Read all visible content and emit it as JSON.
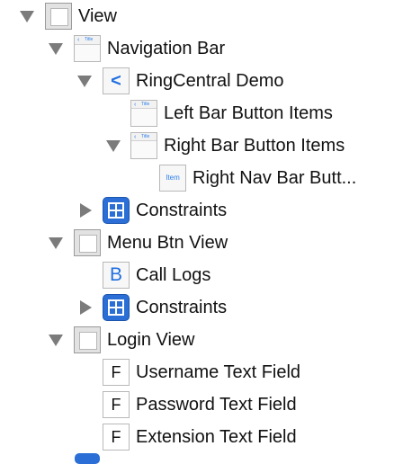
{
  "colors": {
    "disclosure_triangle": "#7b7b7b",
    "accent_blue": "#2b6fd6",
    "icon_border": "#b8b8b8"
  },
  "tree": {
    "view": {
      "label": "View",
      "icon": "view-icon",
      "expanded": true
    },
    "navigation_bar": {
      "label": "Navigation Bar",
      "icon": "navigation-bar-icon",
      "icon_text": "Title",
      "expanded": true
    },
    "ringcentral_demo": {
      "label": "RingCentral Demo",
      "icon": "back-chevron-icon",
      "icon_glyph": "<",
      "expanded": true
    },
    "left_bar_button_items": {
      "label": "Left Bar Button Items",
      "icon": "navigation-bar-icon",
      "icon_text": "Title"
    },
    "right_bar_button_items": {
      "label": "Right Bar Button Items",
      "icon": "navigation-bar-icon",
      "icon_text": "Title",
      "expanded": true
    },
    "right_nav_bar_button": {
      "label": "Right Nav Bar Butt...",
      "icon": "bar-button-item-icon",
      "icon_text": "Item"
    },
    "constraints_1": {
      "label": "Constraints",
      "icon": "constraints-icon",
      "expanded": false
    },
    "menu_btn_view": {
      "label": "Menu Btn View",
      "icon": "view-icon",
      "expanded": true
    },
    "call_logs": {
      "label": "Call Logs",
      "icon": "button-icon",
      "icon_glyph": "B"
    },
    "constraints_2": {
      "label": "Constraints",
      "icon": "constraints-icon",
      "expanded": false
    },
    "login_view": {
      "label": "Login View",
      "icon": "view-icon",
      "expanded": true
    },
    "username_text_field": {
      "label": "Username Text Field",
      "icon": "text-field-icon",
      "icon_glyph": "F"
    },
    "password_text_field": {
      "label": "Password Text Field",
      "icon": "text-field-icon",
      "icon_glyph": "F"
    },
    "extension_text_field": {
      "label": "Extension Text Field",
      "icon": "text-field-icon",
      "icon_glyph": "F"
    }
  }
}
